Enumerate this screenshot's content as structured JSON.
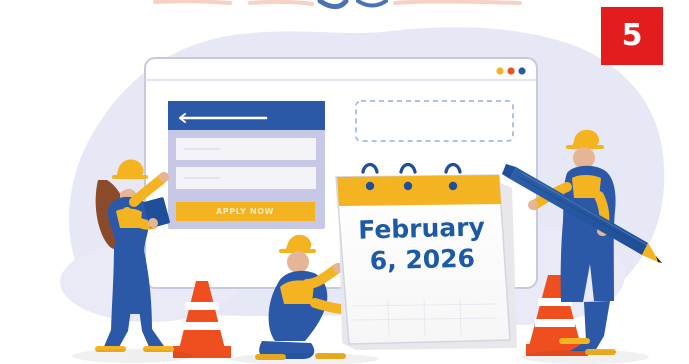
{
  "badge": {
    "number": "5"
  },
  "form_card": {
    "button_label": "APPLY NOW"
  },
  "calendar": {
    "line1": "February",
    "line2": "6, 2026"
  },
  "colors": {
    "badge_red": "#e31d1d",
    "primary_blue": "#2b59a7",
    "accent_yellow": "#f4b321",
    "background_lavender": "#e7e8f5",
    "calendar_text_blue": "#1d5aa6",
    "traffic_cone_orange": "#ef4f1e"
  },
  "icons": {
    "back_arrow": "arrow-left-icon",
    "window_dots": "window-controls-icon"
  }
}
